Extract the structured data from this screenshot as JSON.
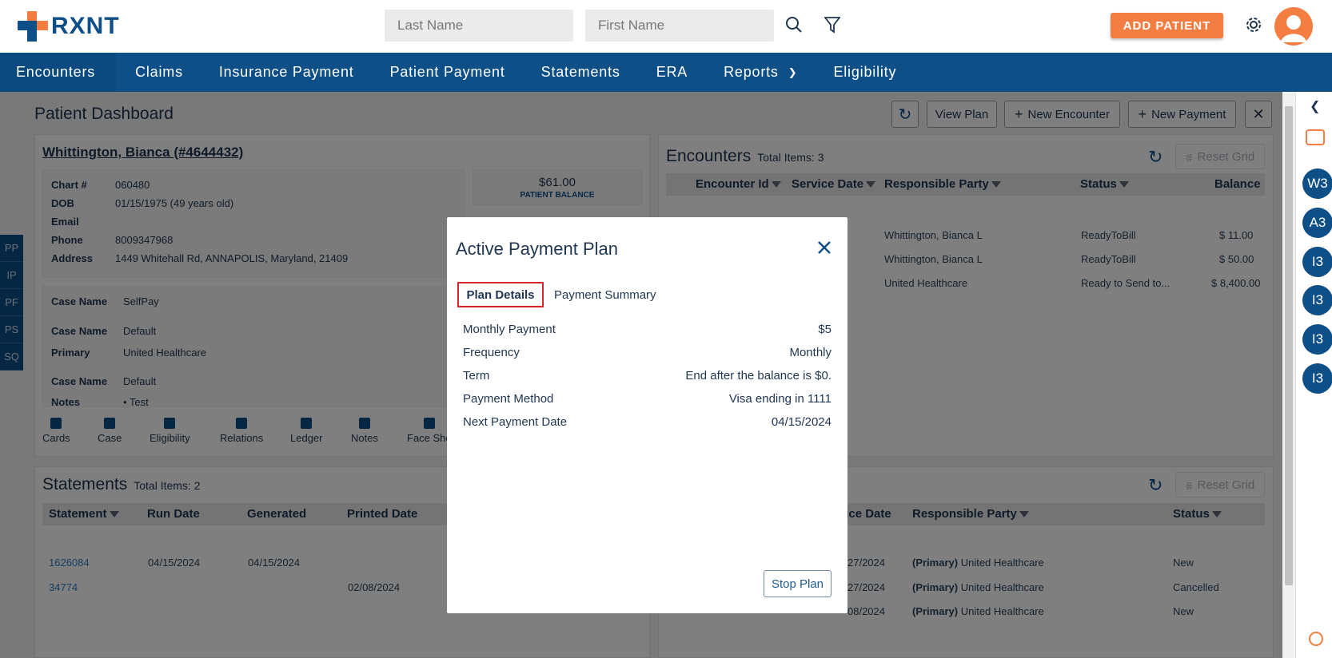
{
  "brand": {
    "name": "RXNT"
  },
  "search": {
    "last_placeholder": "Last Name",
    "first_placeholder": "First Name"
  },
  "header": {
    "add_patient": "ADD PATIENT"
  },
  "nav": [
    "Encounters",
    "Claims",
    "Insurance Payment",
    "Patient Payment",
    "Statements",
    "ERA",
    "Reports",
    "Eligibility"
  ],
  "side_tabs": [
    "PP",
    "IP",
    "PF",
    "PS",
    "SQ"
  ],
  "dashboard": {
    "title": "Patient Dashboard",
    "view_plan": "View Plan",
    "new_encounter": "New Encounter",
    "new_payment": "New Payment"
  },
  "patient": {
    "name": "Whittington, Bianca (#4644432)",
    "balance": "$61.00",
    "balance_label": "PATIENT BALANCE",
    "fields": [
      {
        "k": "Chart #",
        "v": "060480"
      },
      {
        "k": "DOB",
        "v": "01/15/1975 (49 years old)"
      },
      {
        "k": "Email",
        "v": ""
      },
      {
        "k": "Phone",
        "v": "8009347968"
      },
      {
        "k": "Address",
        "v": "1449 Whitehall Rd, ANNAPOLIS, Maryland, 21409"
      }
    ],
    "cases": [
      {
        "k": "Case Name",
        "v": "SelfPay"
      },
      {
        "k": "Case Name",
        "v": "Default"
      },
      {
        "k": "Primary",
        "v": "United Healthcare"
      },
      {
        "k": "Case Name",
        "v": "Default"
      },
      {
        "k": "Notes",
        "v": "• Test"
      }
    ],
    "actions": [
      "Cards",
      "Case",
      "Eligibility",
      "Relations",
      "Ledger",
      "Notes",
      "Face She"
    ]
  },
  "encounters": {
    "title": "Encounters",
    "total": "Total Items: 3",
    "reset": "Reset Grid",
    "columns": [
      "Encounter Id",
      "Service Date",
      "Responsible Party",
      "Status",
      "Balance"
    ],
    "rows": [
      {
        "party": "Whittington, Bianca L",
        "status": "ReadyToBill",
        "balance": "$ 11.00"
      },
      {
        "party": "Whittington, Bianca L",
        "status": "ReadyToBill",
        "balance": "$ 50.00"
      },
      {
        "party": "United Healthcare",
        "status": "Ready to Send to...",
        "balance": "$ 8,400.00"
      }
    ]
  },
  "statements": {
    "title": "Statements",
    "total": "Total Items: 2",
    "columns": [
      "Statement",
      "Run Date",
      "Generated",
      "Printed Date"
    ],
    "rows": [
      {
        "id": "1626084",
        "run": "04/15/2024",
        "gen": "04/15/2024",
        "printed": ""
      },
      {
        "id": "34774",
        "run": "",
        "gen": "",
        "printed": "02/08/2024"
      }
    ]
  },
  "claims": {
    "reset": "Reset Grid",
    "columns": [
      "rvice Date",
      "Responsible Party",
      "Status"
    ],
    "rows": [
      {
        "date": "27/2024",
        "prefix": "(Primary)",
        "party": "United Healthcare",
        "status": "New"
      },
      {
        "date": "27/2024",
        "prefix": "(Primary)",
        "party": "United Healthcare",
        "status": "Cancelled"
      },
      {
        "date": "08/2024",
        "prefix": "(Primary)",
        "party": "United Healthcare",
        "status": "New"
      }
    ]
  },
  "modal": {
    "title": "Active Payment Plan",
    "tabs": [
      "Plan Details",
      "Payment Summary"
    ],
    "details": [
      {
        "k": "Monthly Payment",
        "v": "$5"
      },
      {
        "k": "Frequency",
        "v": "Monthly"
      },
      {
        "k": "Term",
        "v": "End after the balance is $0."
      },
      {
        "k": "Payment Method",
        "v": "Visa ending in 1111"
      },
      {
        "k": "Next Payment Date",
        "v": "04/15/2024"
      }
    ],
    "stop_plan": "Stop Plan"
  },
  "rail": [
    "W3",
    "A3",
    "I3",
    "I3",
    "I3",
    "I3"
  ],
  "colors": {
    "brand_blue": "#0d4f86",
    "accent_orange": "#f47d42",
    "highlight_red": "#d9232a"
  }
}
